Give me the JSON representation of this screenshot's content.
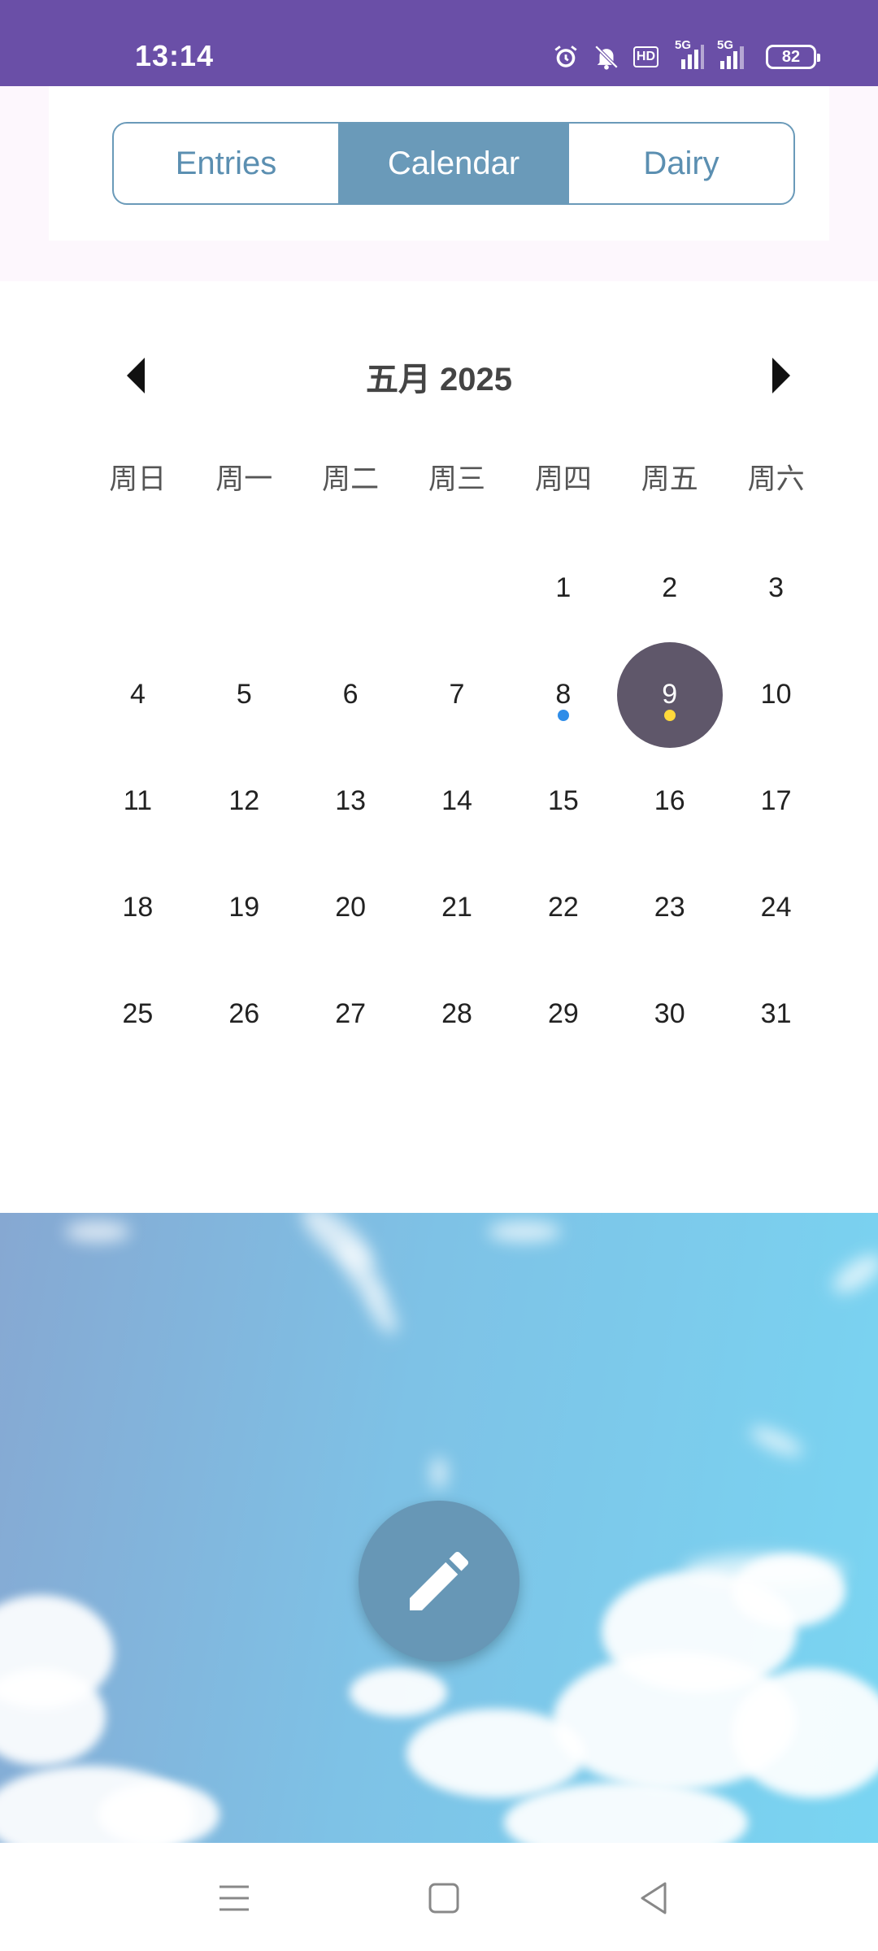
{
  "status_bar": {
    "time": "13:14",
    "network_label_1": "5G",
    "network_label_2": "5G",
    "hd_label": "HD",
    "battery": "82"
  },
  "tabs": [
    {
      "label": "Entries",
      "active": false
    },
    {
      "label": "Calendar",
      "active": true
    },
    {
      "label": "Dairy",
      "active": false
    }
  ],
  "calendar": {
    "month_title": "五月 2025",
    "weekdays": [
      "周日",
      "周一",
      "周二",
      "周三",
      "周四",
      "周五",
      "周六"
    ],
    "leading_blanks": 4,
    "days": [
      "1",
      "2",
      "3",
      "4",
      "5",
      "6",
      "7",
      "8",
      "9",
      "10",
      "11",
      "12",
      "13",
      "14",
      "15",
      "16",
      "17",
      "18",
      "19",
      "20",
      "21",
      "22",
      "23",
      "24",
      "25",
      "26",
      "27",
      "28",
      "29",
      "30",
      "31"
    ],
    "selected_day": "9",
    "markers": [
      {
        "day": "8",
        "color": "#2f8de8"
      },
      {
        "day": "9",
        "color": "#ffd93b"
      }
    ]
  },
  "colors": {
    "status_bar": "#6a4fa7",
    "accent": "#6a9ab9",
    "selected_circle": "#5f576a",
    "fab": "#6797b6"
  },
  "icons": {
    "fab": "pencil-icon",
    "nav_prev": "triangle-left-icon",
    "nav_next": "triangle-right-icon"
  }
}
